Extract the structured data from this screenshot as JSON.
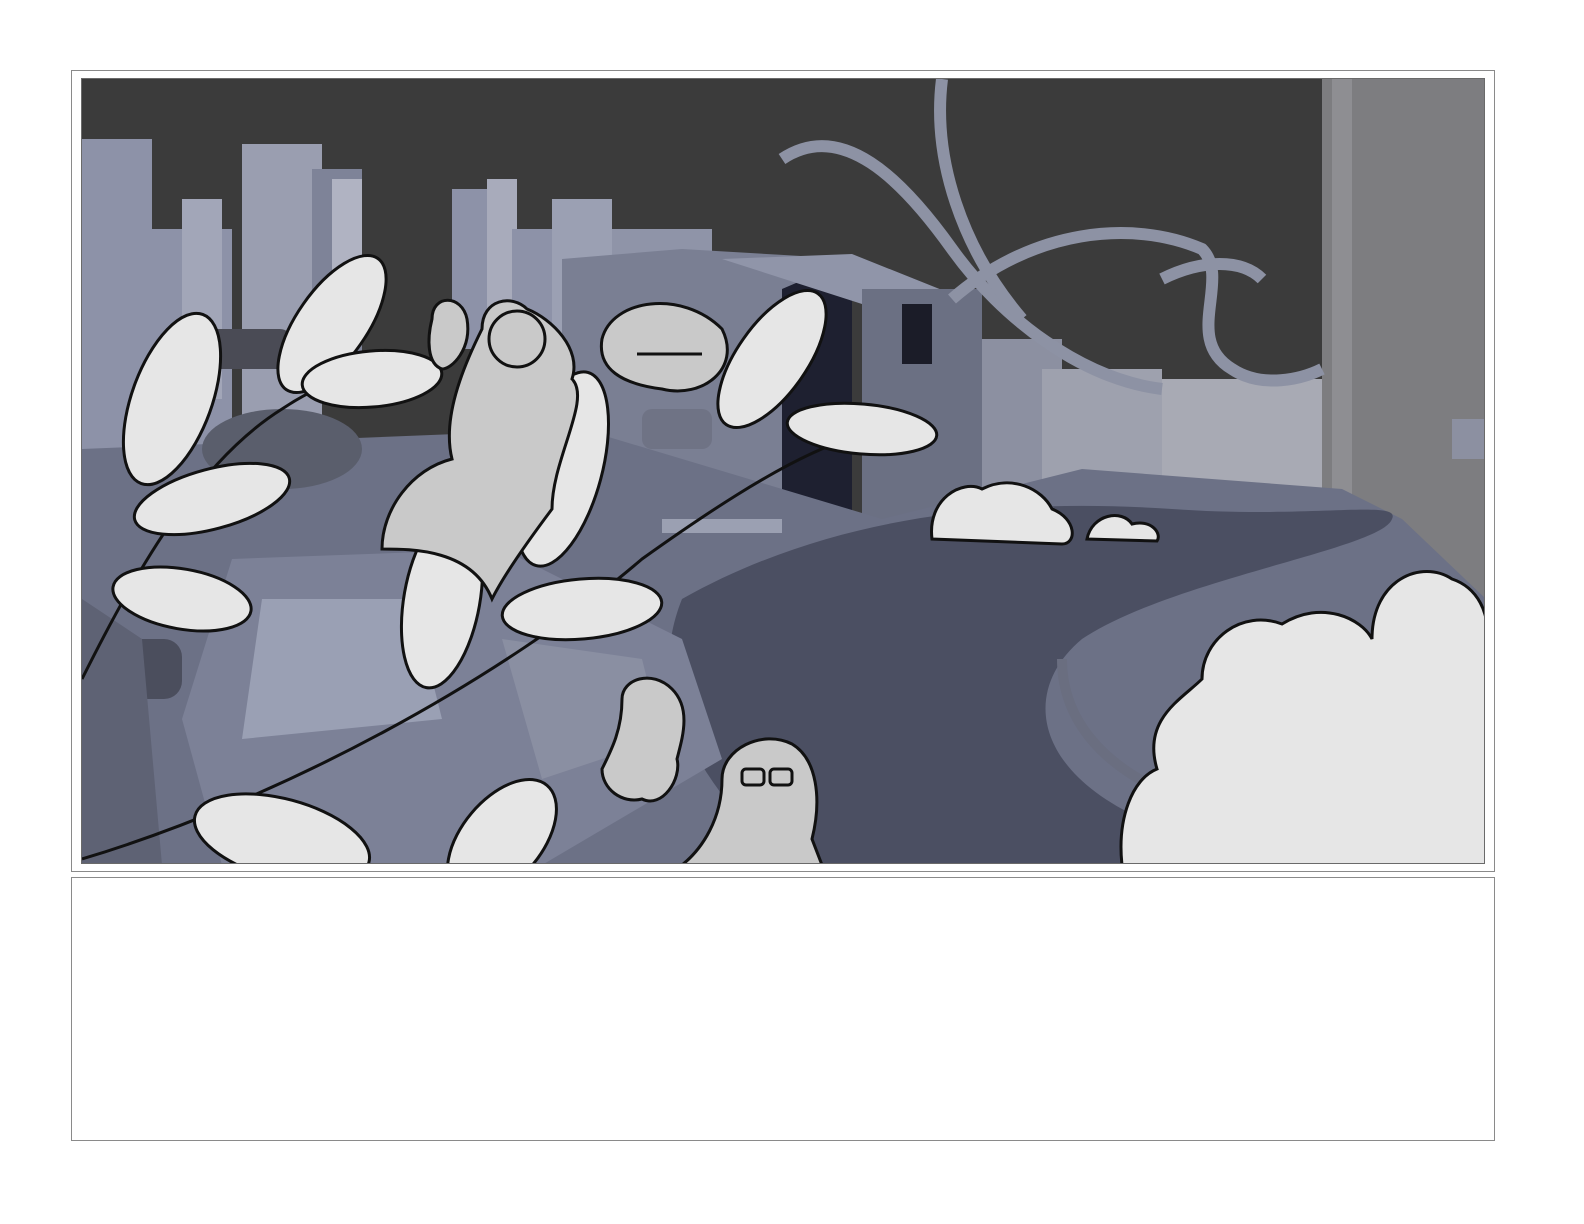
{
  "storyboard": {
    "panel_image": {
      "description_icon": "storyboard-panel-illustration"
    },
    "notes": {
      "text": ""
    }
  },
  "colors": {
    "sky": "#3b3b3b",
    "building": "#8a8fa3",
    "building_dark": "#555a6e",
    "road": "#4a4e60",
    "sketch_fill": "#e6e6e6",
    "ink": "#111111"
  }
}
